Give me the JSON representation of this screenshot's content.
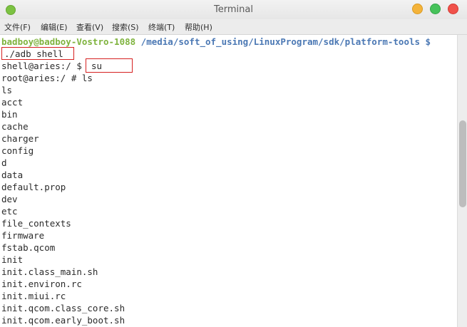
{
  "window": {
    "title": "Terminal"
  },
  "menu": {
    "items": [
      {
        "label": "文件(F)"
      },
      {
        "label": "编辑(E)"
      },
      {
        "label": "查看(V)"
      },
      {
        "label": "搜索(S)"
      },
      {
        "label": "终端(T)"
      },
      {
        "label": "帮助(H)"
      }
    ]
  },
  "terminal": {
    "prompt_user": "badboy@badboy-Vostro-1088",
    "prompt_path": " /media/soft_of_using/LinuxProgram/sdk/platform-tools $",
    "command1": "./adb shell",
    "shell_prompt": "shell@aries:/ $ ",
    "command2": "su",
    "root_prompt": "root@aries:/ # ls",
    "output": [
      "ls",
      "acct",
      "bin",
      "cache",
      "charger",
      "config",
      "d",
      "data",
      "default.prop",
      "dev",
      "etc",
      "file_contexts",
      "firmware",
      "fstab.qcom",
      "init",
      "init.class_main.sh",
      "init.environ.rc",
      "init.miui.rc",
      "init.qcom.class_core.sh",
      "init.qcom.early_boot.sh"
    ]
  },
  "colors": {
    "prompt_user": "#7fb33e",
    "prompt_path": "#4b78b4",
    "highlight_border": "#d62020"
  }
}
